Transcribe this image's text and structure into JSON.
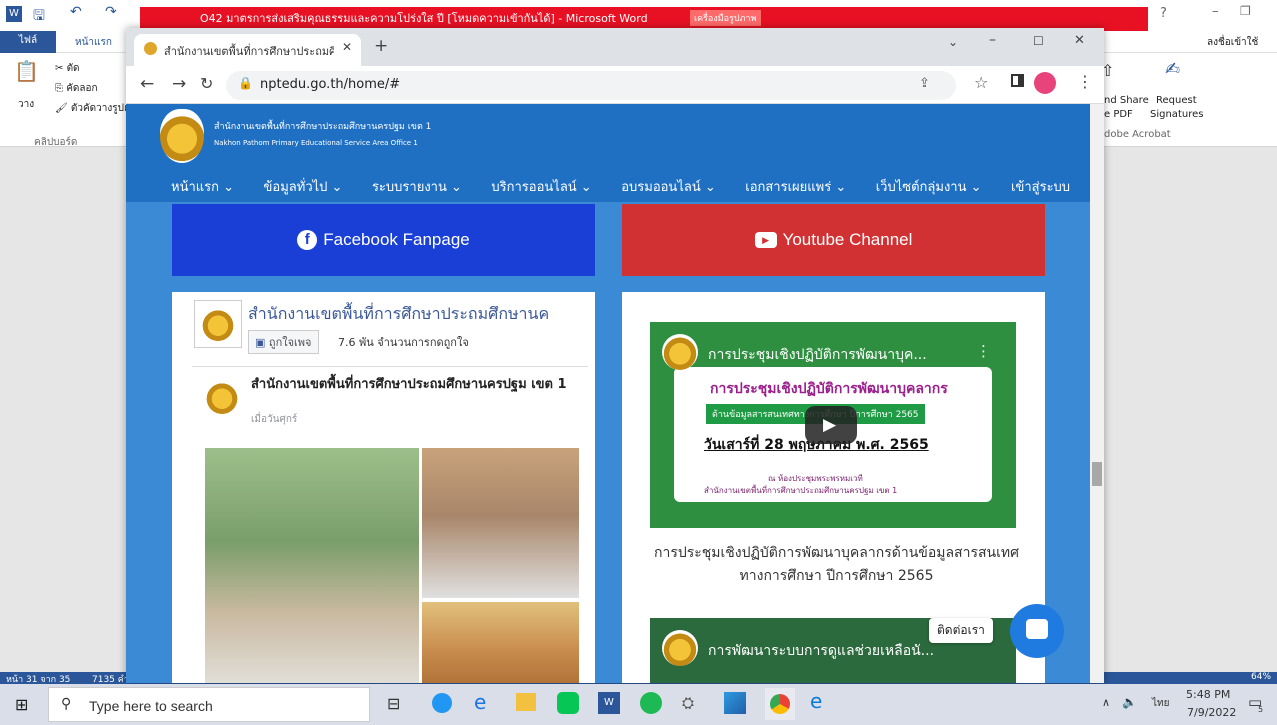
{
  "word": {
    "doc_title": "O42 มาตรการส่งเสริมคุณธรรมและความโปร่งใส ปี [โหมดความเข้ากันได้] - Microsoft Word",
    "picture_tools_tab": "เครื่องมือรูปภาพ",
    "tab_file": "ไฟล์",
    "tab_home": "หน้าแรก",
    "cut": "ตัด",
    "copy": "คัดลอก",
    "paste": "วาง",
    "format_painter": "ตัวคัดวางรูปแบ",
    "clipboard": "คลิปบอร์ด",
    "sign_in": "ลงชื่อเข้าใช้",
    "acrobat_share": "nd Share",
    "acrobat_pdf": "e PDF",
    "acrobat_request": "Request",
    "acrobat_signatures": "Signatures",
    "acrobat_group": "dobe Acrobat",
    "status_page": "หน้า 31 จาก 35",
    "status_words": "7135 คำ",
    "zoom": "64%"
  },
  "browser": {
    "tab_title": "สำนักงานเขตพื้นที่การศึกษาประถมศึก",
    "url": "nptedu.go.th/home/#"
  },
  "site": {
    "name_th": "สำนักงานเขตพื้นที่การศึกษาประถมศึกษานครปฐม เขต 1",
    "name_en": "Nakhon Pathom Primary Educational Service Area Office 1",
    "nav": [
      "หน้าแรก",
      "ข้อมูลทั่วไป",
      "ระบบรายงาน",
      "บริการออนไลน์",
      "อบรมออนไลน์",
      "เอกสารเผยแพร่",
      "เว็บไซต์กลุ่มงาน",
      "เข้าสู่ระบบ"
    ],
    "facebook_label": "Facebook Fanpage",
    "youtube_label": "Youtube Channel",
    "fb_page_name": "สำนักงานเขตพื้นที่การศึกษาประถมศึกษานค",
    "fb_like_button": "ถูกใจเพจ",
    "fb_likes": "7.6 พัน จำนวนการกดถูกใจ",
    "fb_post_author": "สำนักงานเขตพื้นที่การศึกษาประถมศึกษานครปฐม เขต 1",
    "fb_post_time": "เมื่อวันศุกร์",
    "video1_title": "การประชุมเชิงปฏิบัติการพัฒนาบุค...",
    "video1_headline": "การประชุมเชิงปฏิบัติการพัฒนาบุคลากร",
    "video1_sub": "ด้านข้อมูลสารสนเทศทางการศึกษา ปีการศึกษา 2565",
    "video1_date": "วันเสาร์ที่ 28 พฤษภาคม พ.ศ. 2565",
    "video1_place1": "ณ ห้องประชุมพระพรหมเวที",
    "video1_place2": "สำนักงานเขตพื้นที่การศึกษาประถมศึกษานครปฐม เขต 1",
    "video1_caption": "การประชุมเชิงปฏิบัติการพัฒนาบุคลากรด้านข้อมูลสารสนเทศทางการศึกษา ปีการศึกษา 2565",
    "video2_title": "การพัฒนาระบบการดูแลช่วยเหลือนั...",
    "contact_label": "ติดต่อเรา"
  },
  "taskbar": {
    "search_placeholder": "Type here to search",
    "lang": "ไทย",
    "time": "5:48 PM",
    "date": "7/9/2022",
    "notif_count": "5"
  },
  "colors": {
    "word_blue": "#2b579a",
    "site_header": "#1f6fc2",
    "facebook": "#1a3fd6",
    "youtube": "#d13133"
  }
}
